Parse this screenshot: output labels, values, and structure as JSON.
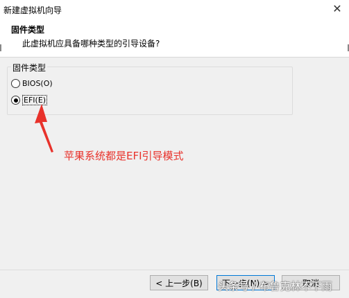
{
  "window": {
    "title": "新建虚拟机向导",
    "close_glyph": "✕"
  },
  "header": {
    "title": "固件类型",
    "subtitle": "此虚拟机应具备哪种类型的引导设备?"
  },
  "group": {
    "label": "固件类型",
    "options": [
      {
        "label": "BIOS(O)",
        "checked": false
      },
      {
        "label": "EFI(E)",
        "checked": true
      }
    ]
  },
  "annotation": {
    "text": "苹果系统都是EFI引导模式",
    "color": "#e8322b"
  },
  "buttons": {
    "back": "< 上一步(B)",
    "next": "下一步(N) >",
    "cancel": "取消"
  },
  "watermark": {
    "text": "头条号 / 布鲁克林不下雨"
  }
}
